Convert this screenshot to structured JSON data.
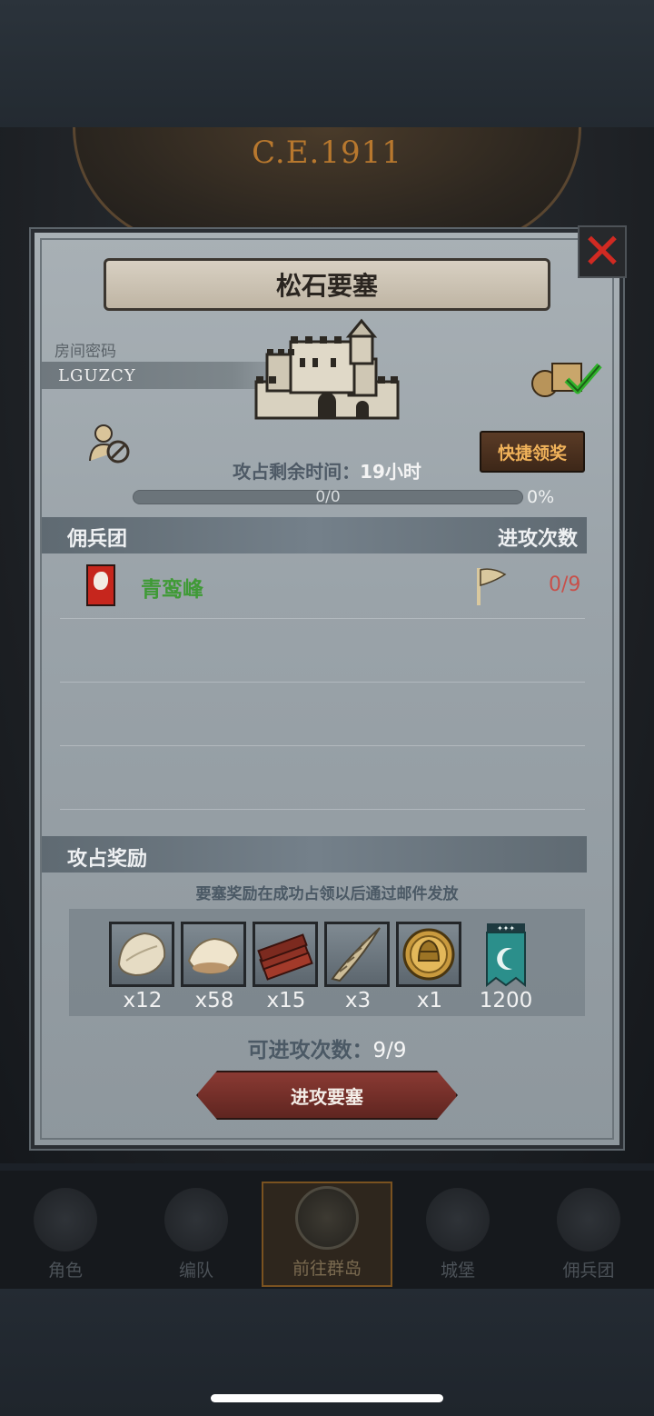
{
  "scene": {
    "year": "C.E.1911"
  },
  "dialog": {
    "title": "松石要塞",
    "room_code_label": "房间密码",
    "room_code": "LGUZCY",
    "quick_claim_label": "快捷领奖",
    "remaining_time_label": "攻占剩余时间：",
    "remaining_time_value": "19小时",
    "progress_text": "0/0",
    "progress_percent": "0%",
    "progress_fraction": 0
  },
  "mercenaries": {
    "header_label": "佣兵团",
    "attacks_header": "进攻次数",
    "rows": [
      {
        "name": "青鸾峰",
        "attacks": "0/9"
      }
    ]
  },
  "rewards": {
    "header_label": "攻占奖励",
    "note": "要塞奖励在成功占领以后通过邮件发放",
    "items": [
      {
        "icon": "fur-pelt-icon",
        "count": "x12"
      },
      {
        "icon": "wool-fleece-icon",
        "count": "x58"
      },
      {
        "icon": "lumber-planks-icon",
        "count": "x15"
      },
      {
        "icon": "twisted-horn-icon",
        "count": "x3"
      },
      {
        "icon": "knight-helmet-coin-icon",
        "count": "x1"
      },
      {
        "icon": "teal-banner-icon",
        "count": "1200"
      }
    ]
  },
  "attacks_left_label": "可进攻次数：",
  "attacks_left_value": "9/9",
  "attack_button_label": "进攻要塞",
  "nav": {
    "items": [
      {
        "label": "角色",
        "icon": "knight-portrait-icon"
      },
      {
        "label": "编队",
        "icon": "armored-knight-icon"
      },
      {
        "label": "前往群岛",
        "icon": "globe-compass-icon"
      },
      {
        "label": "城堡",
        "icon": "castle-icon"
      },
      {
        "label": "佣兵团",
        "icon": "ship-icon"
      }
    ]
  },
  "colors": {
    "merc_name": "#3f9a36",
    "attack_count": "#c8504a",
    "quick_claim_text": "#f0b25a",
    "attack_button": "#7a302a",
    "close_x": "#d02a22"
  }
}
